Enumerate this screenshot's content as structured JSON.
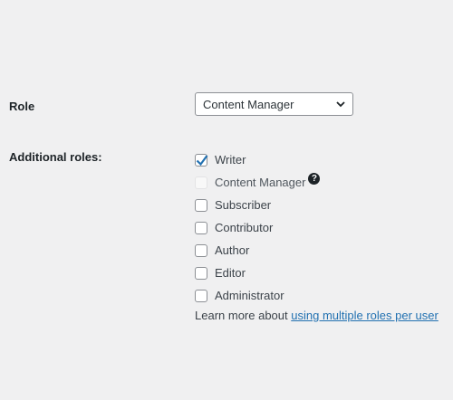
{
  "role": {
    "label": "Role",
    "selected": "Content Manager"
  },
  "additional_roles": {
    "label": "Additional roles:",
    "items": [
      {
        "label": "Writer",
        "checked": true,
        "disabled": false
      },
      {
        "label": "Content Manager",
        "checked": false,
        "disabled": true
      },
      {
        "label": "Subscriber",
        "checked": false,
        "disabled": false
      },
      {
        "label": "Contributor",
        "checked": false,
        "disabled": false
      },
      {
        "label": "Author",
        "checked": false,
        "disabled": false
      },
      {
        "label": "Editor",
        "checked": false,
        "disabled": false
      },
      {
        "label": "Administrator",
        "checked": false,
        "disabled": false
      }
    ],
    "help_glyph": "?"
  },
  "learn_more": {
    "prefix": "Learn more about",
    "link_text": "using multiple roles per user"
  },
  "colors": {
    "background": "#f0f0f1",
    "link": "#2271b1",
    "checkmark": "#2271b1"
  }
}
